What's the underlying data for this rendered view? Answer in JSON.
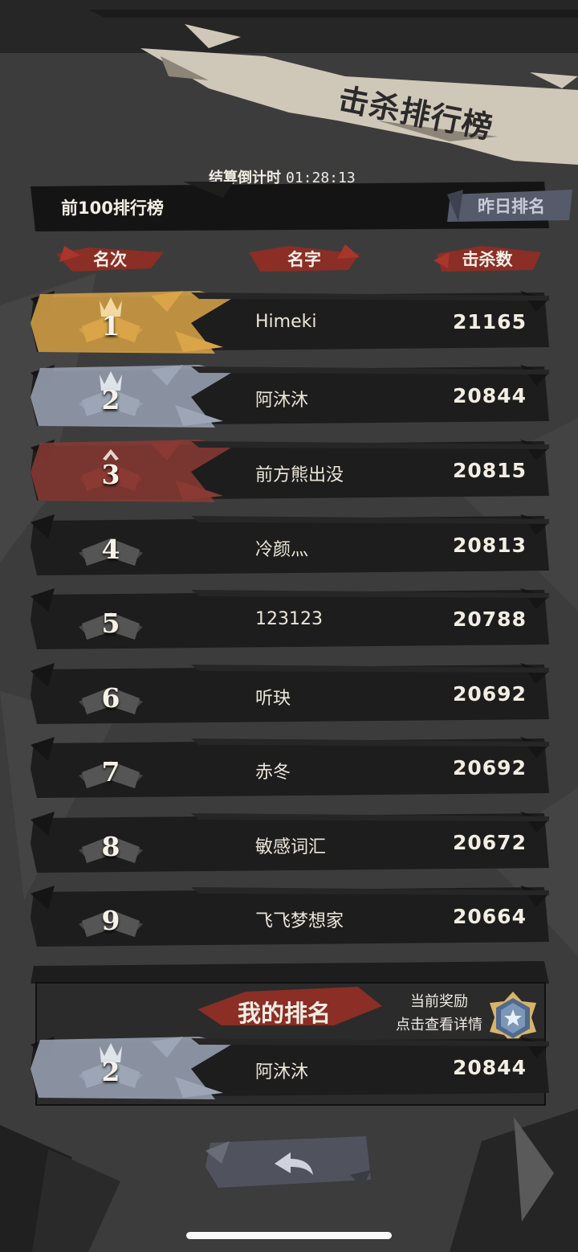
{
  "title": "击杀排行榜",
  "countdown": {
    "label": "结算倒计时",
    "time": "01:28:13"
  },
  "top_bar": {
    "label": "前100排行榜",
    "yesterday_button": "昨日排名"
  },
  "columns": {
    "rank": "名次",
    "name": "名字",
    "kills": "击杀数"
  },
  "rows": [
    {
      "rank": "1",
      "name": "Himeki",
      "kills": "21165",
      "tier": "gold"
    },
    {
      "rank": "2",
      "name": "阿沐沐",
      "kills": "20844",
      "tier": "silver"
    },
    {
      "rank": "3",
      "name": "前方熊出没",
      "kills": "20815",
      "tier": "bronze"
    },
    {
      "rank": "4",
      "name": "冷颜灬",
      "kills": "20813",
      "tier": "normal"
    },
    {
      "rank": "5",
      "name": "123123",
      "kills": "20788",
      "tier": "normal"
    },
    {
      "rank": "6",
      "name": "听玦",
      "kills": "20692",
      "tier": "normal"
    },
    {
      "rank": "7",
      "name": "赤冬",
      "kills": "20692",
      "tier": "normal"
    },
    {
      "rank": "8",
      "name": "敏感词汇",
      "kills": "20672",
      "tier": "normal"
    },
    {
      "rank": "9",
      "name": "飞飞梦想家",
      "kills": "20664",
      "tier": "normal"
    }
  ],
  "my_rank": {
    "title": "我的排名",
    "reward_line1": "当前奖励",
    "reward_line2": "点击查看详情",
    "rank": "2",
    "name": "阿沐沐",
    "kills": "20844",
    "tier": "silver"
  },
  "colors": {
    "gold": "#d9a548",
    "silver": "#9ca6b7",
    "bronze": "#8a3a32",
    "normal": "#555555",
    "accent_red": "#a8362a",
    "banner": "#cfc7b8"
  },
  "icons": {
    "back": "back-arrow-icon",
    "reward": "medal-icon"
  }
}
